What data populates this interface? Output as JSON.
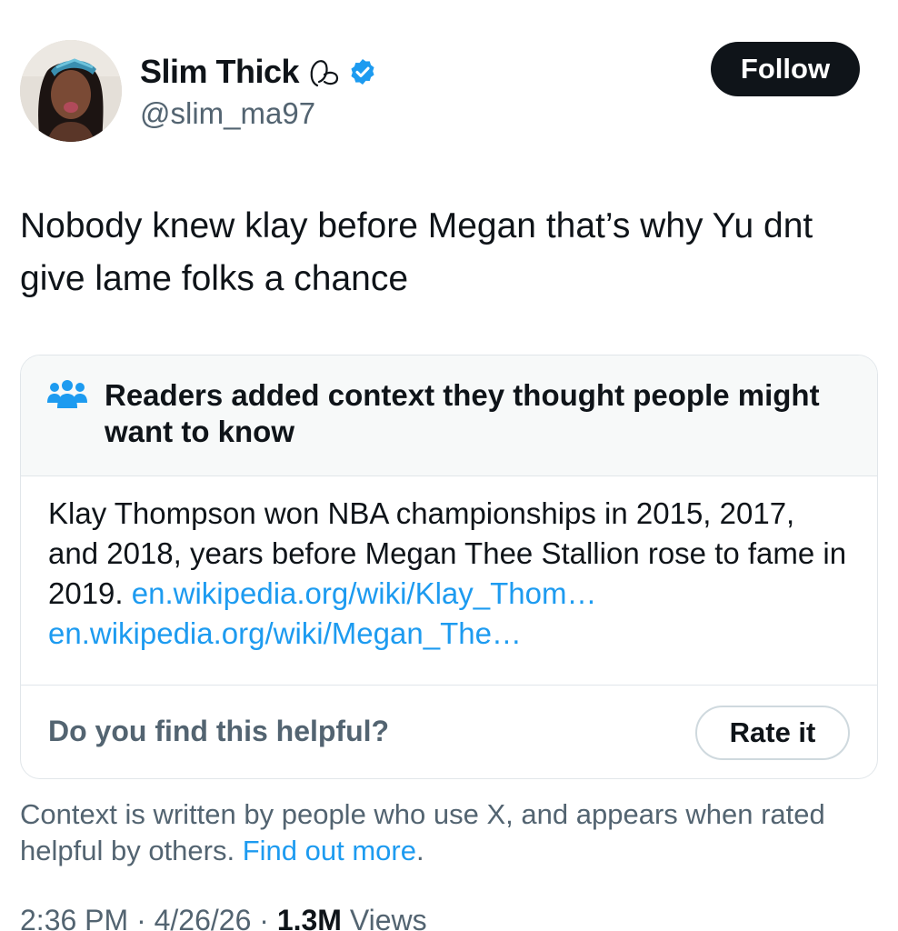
{
  "user": {
    "name": "Slim Thick",
    "emoji_icon": "peach-outline-emoji",
    "handle": "@slim_ma97",
    "verified_color": "#1d9bf0"
  },
  "follow_button": {
    "label": "Follow"
  },
  "tweet": {
    "text": "Nobody knew klay before Megan that’s why Yu dnt give lame folks a chance"
  },
  "community_note": {
    "title": "Readers added context they thought people might want to know",
    "body_text": "Klay Thompson won NBA championships in 2015, 2017, and 2018, years before Megan Thee Stallion rose to fame in 2019.",
    "link_1": "en.wikipedia.org/wiki/Klay_Thom…",
    "link_2": "en.wikipedia.org/wiki/Megan_The…",
    "helpful_question": "Do you find this helpful?",
    "rate_button": "Rate it"
  },
  "disclaimer": {
    "text": "Context is written by people who use X, and appears when rated helpful by others.",
    "link": "Find out more",
    "trailing": "."
  },
  "meta": {
    "time": "2:36 PM",
    "separator": "·",
    "date": "4/26/26",
    "views_count": "1.3M",
    "views_label": "Views"
  },
  "colors": {
    "text_primary": "#0f1419",
    "text_secondary": "#536471",
    "link": "#1d9bf0",
    "note_header_bg": "#f7f9f9",
    "border": "#e1e6ea"
  }
}
